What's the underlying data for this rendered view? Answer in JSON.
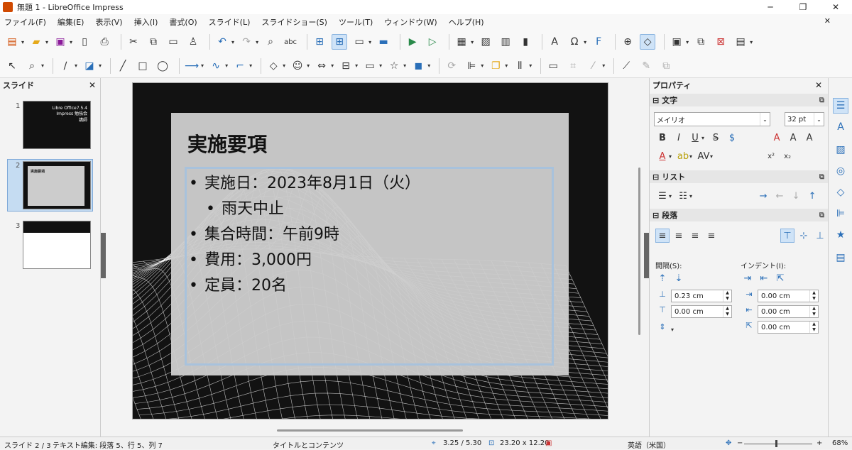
{
  "window": {
    "title": "無題 1 - LibreOffice Impress",
    "min": "─",
    "max": "❐",
    "close": "✕"
  },
  "menu": [
    "ファイル(F)",
    "編集(E)",
    "表示(V)",
    "挿入(I)",
    "書式(O)",
    "スライド(L)",
    "スライドショー(S)",
    "ツール(T)",
    "ウィンドウ(W)",
    "ヘルプ(H)"
  ],
  "menu_close": "✕",
  "slide_panel": {
    "title": "スライド",
    "close": "✕",
    "slides": [
      {
        "num": "1",
        "text1": "Libre Office7.5.4",
        "text2": "Impress 勉強会",
        "text3": "講師"
      },
      {
        "num": "2",
        "text1": "実施要項"
      },
      {
        "num": "3"
      }
    ]
  },
  "slide": {
    "title": "実施要項",
    "bullets": [
      {
        "text": "実施日：2023年8月1日（火）",
        "level": 1
      },
      {
        "text": "雨天中止",
        "level": 2
      },
      {
        "text": "集合時間：午前9時",
        "level": 1
      },
      {
        "text": "費用：3,000円",
        "level": 1
      },
      {
        "text": "定員：20名",
        "level": 1
      }
    ]
  },
  "props": {
    "title": "プロパティ",
    "close": "✕",
    "sec_char": "文字",
    "font_name": "メイリオ",
    "font_size": "32 pt",
    "sec_list": "リスト",
    "sec_para": "段落",
    "spacing_label": "間隔(S):",
    "indent_label": "インデント(I):",
    "above": "0.23 cm",
    "below": "0.00 cm",
    "indent_before": "0.00 cm",
    "indent_after": "0.00 cm",
    "indent_first": "0.00 cm"
  },
  "status": {
    "slide": "スライド 2 / 3",
    "edit": "テキスト編集: 段落 5、行 5、列 7",
    "layout": "タイトルとコンテンツ",
    "pos": "3.25 / 5.30",
    "size": "23.20 x 12.20",
    "lang": "英語（米国）",
    "zoom": "68%",
    "minus": "−",
    "plus": "+"
  }
}
